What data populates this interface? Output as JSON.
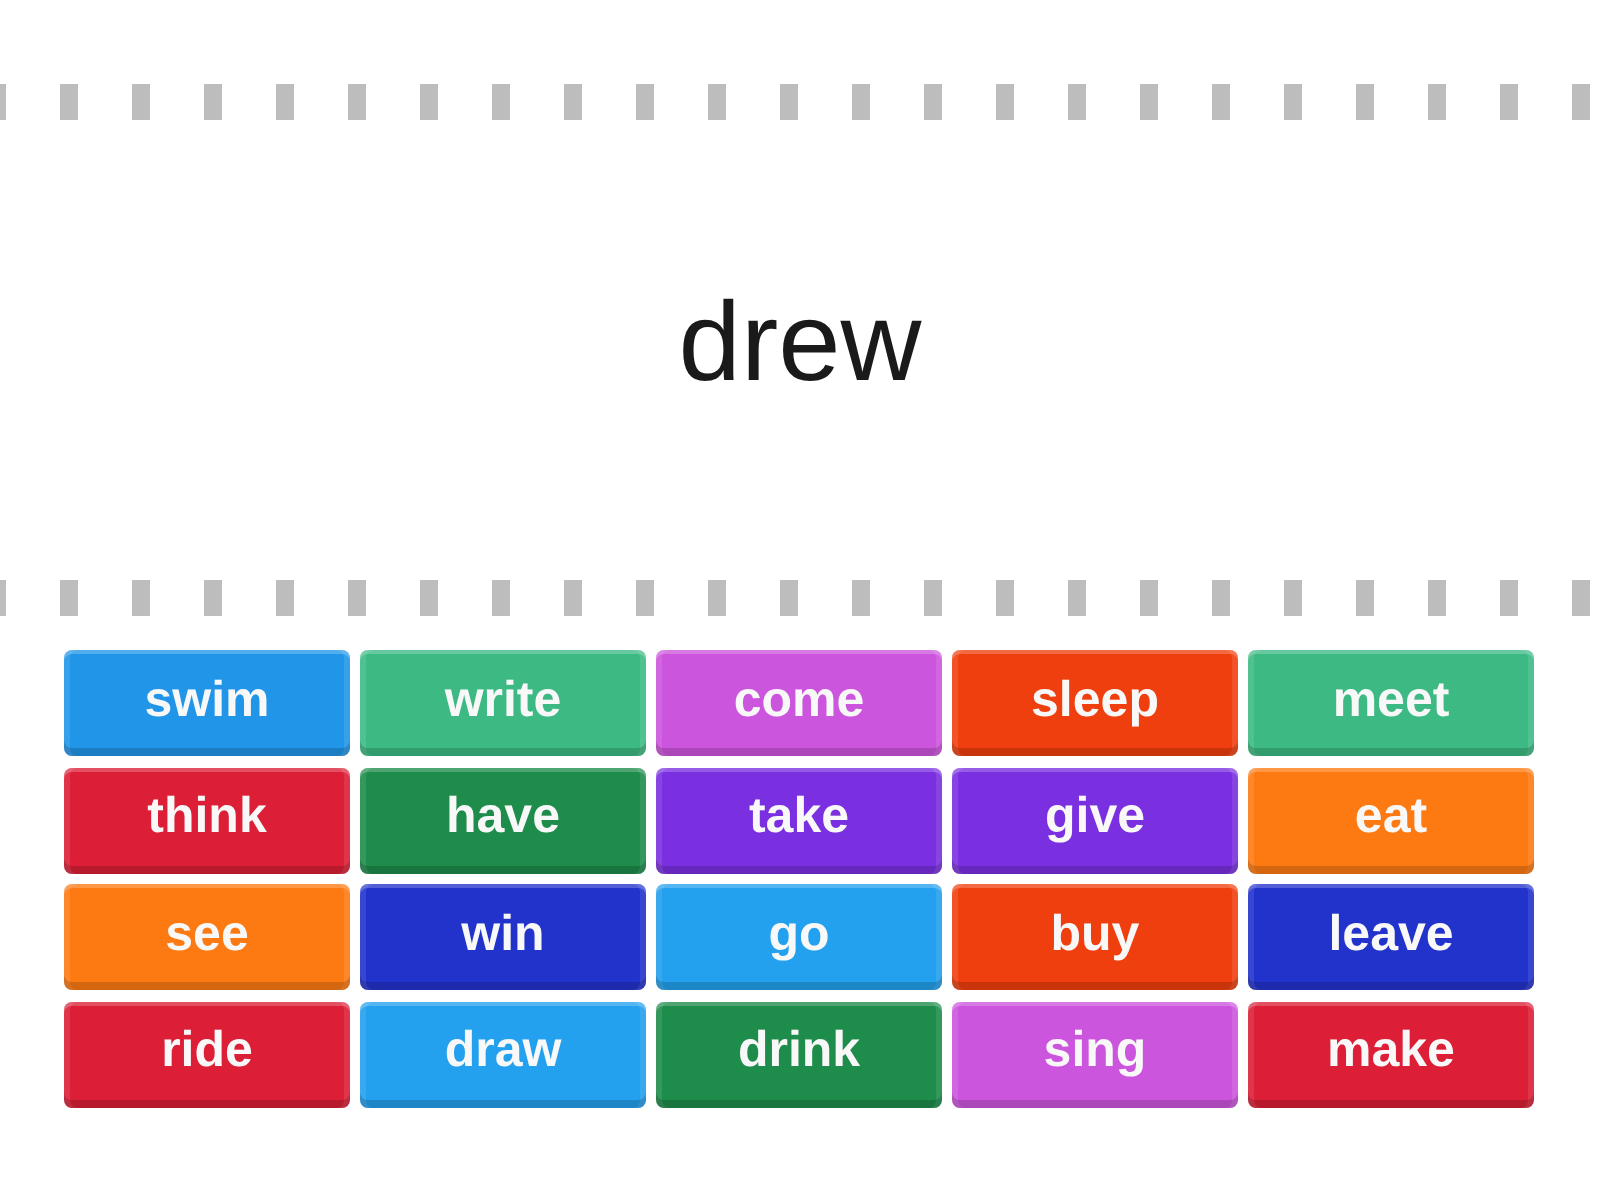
{
  "question": {
    "text": "drew"
  },
  "answers": [
    {
      "label": "swim",
      "color": "#2196e8"
    },
    {
      "label": "write",
      "color": "#3dba84"
    },
    {
      "label": "come",
      "color": "#cc55dd"
    },
    {
      "label": "sleep",
      "color": "#f03f0e"
    },
    {
      "label": "meet",
      "color": "#3dba84"
    },
    {
      "label": "think",
      "color": "#dc1f36"
    },
    {
      "label": "have",
      "color": "#1e8c4a"
    },
    {
      "label": "take",
      "color": "#7a2fe0"
    },
    {
      "label": "give",
      "color": "#7a2fe0"
    },
    {
      "label": "eat",
      "color": "#fd7a12"
    },
    {
      "label": "see",
      "color": "#fd7a12"
    },
    {
      "label": "win",
      "color": "#2233cc"
    },
    {
      "label": "go",
      "color": "#23a0ee"
    },
    {
      "label": "buy",
      "color": "#f03f0e"
    },
    {
      "label": "leave",
      "color": "#2233cc"
    },
    {
      "label": "ride",
      "color": "#dc1f36"
    },
    {
      "label": "draw",
      "color": "#23a0ee"
    },
    {
      "label": "drink",
      "color": "#1e8c4a"
    },
    {
      "label": "sing",
      "color": "#cc55dd"
    },
    {
      "label": "make",
      "color": "#dc1f36"
    }
  ]
}
